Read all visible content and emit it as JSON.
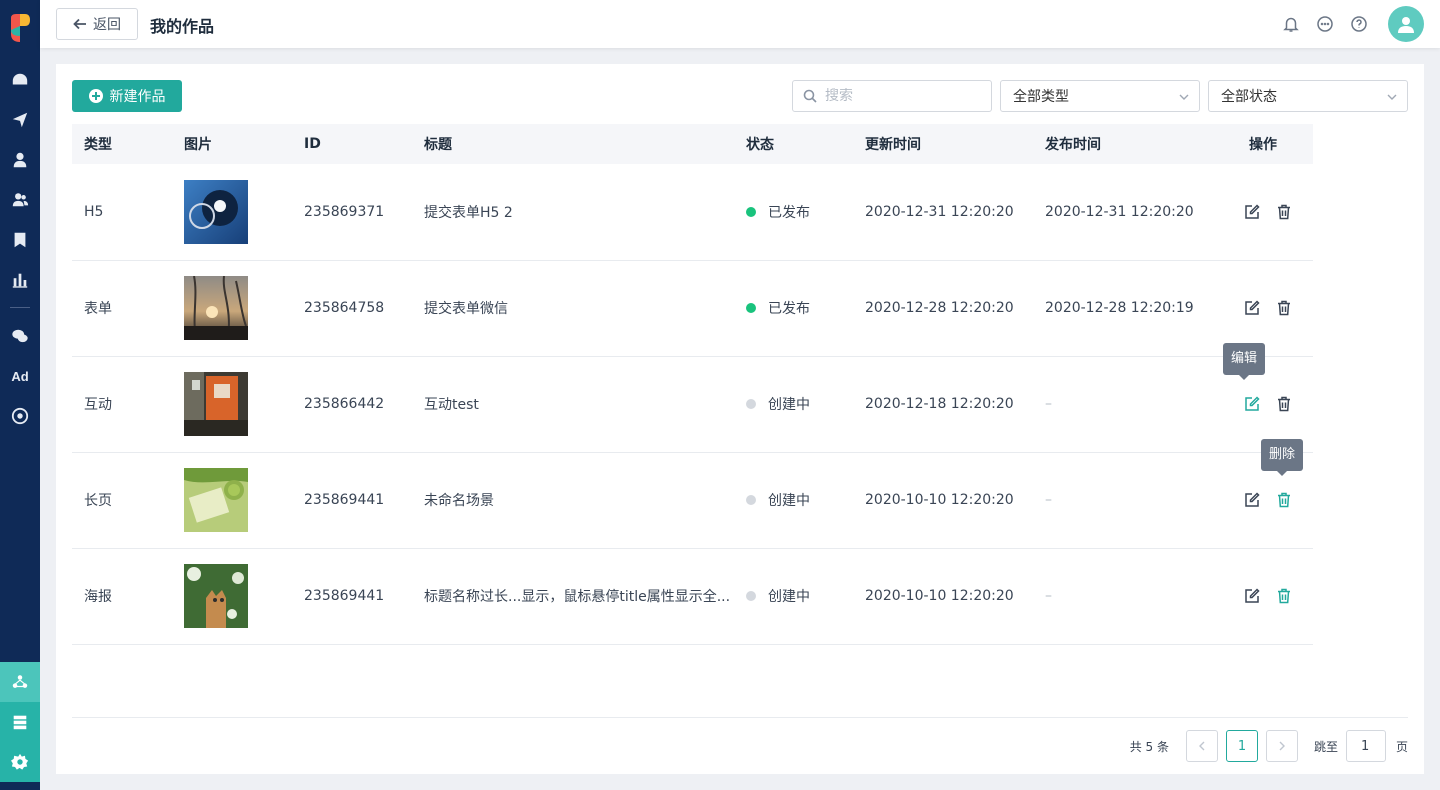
{
  "header": {
    "back_label": "返回",
    "title": "我的作品"
  },
  "sidebar": {
    "items": [
      "dashboard-icon",
      "send-icon",
      "user-icon",
      "users-icon",
      "bookmark-icon",
      "bar-chart-icon",
      "wechat-icon",
      "Ad",
      "target-icon"
    ],
    "bottom_items": [
      "works-icon",
      "server-icon",
      "settings-icon"
    ]
  },
  "toolbar": {
    "new_label": "新建作品",
    "search_placeholder": "搜索",
    "type_select": "全部类型",
    "status_select": "全部状态"
  },
  "table": {
    "columns": [
      "类型",
      "图片",
      "ID",
      "标题",
      "状态",
      "更新时间",
      "发布时间",
      "操作"
    ],
    "rows": [
      {
        "type": "H5",
        "id": "235869371",
        "title": "提交表单H5 2",
        "status": "已发布",
        "status_color": "#19c37d",
        "updated": "2020-12-31  12:20:20",
        "published": "2020-12-31  12:20:20",
        "thumb": "blue"
      },
      {
        "type": "表单",
        "id": "235864758",
        "title": "提交表单微信",
        "status": "已发布",
        "status_color": "#19c37d",
        "updated": "2020-12-28  12:20:20",
        "published": "2020-12-28  12:20:19",
        "thumb": "sunset"
      },
      {
        "type": "互动",
        "id": "235866442",
        "title": "互动test",
        "status": "创建中",
        "status_color": "#d4d8de",
        "updated": "2020-12-18  12:20:20",
        "published": "–",
        "thumb": "orange"
      },
      {
        "type": "长页",
        "id": "235869441",
        "title": "未命名场景",
        "status": "创建中",
        "status_color": "#d4d8de",
        "updated": "2020-10-10 12:20:20",
        "published": "–",
        "thumb": "green"
      },
      {
        "type": "海报",
        "id": "235869441",
        "title": "标题名称过长...显示，鼠标悬停title属性显示全...",
        "status": "创建中",
        "status_color": "#d4d8de",
        "updated": "2020-10-10 12:20:20",
        "published": "–",
        "thumb": "cat"
      }
    ]
  },
  "tooltips": {
    "edit": "编辑",
    "delete": "删除"
  },
  "pagination": {
    "total": "共 5 条",
    "current": "1",
    "jump_label": "跳至",
    "jump_value": "1",
    "page_suffix": "页"
  },
  "colors": {
    "accent": "#22a99d",
    "sidebar": "#0f2a57",
    "published": "#19c37d",
    "draft": "#d4d8de"
  }
}
